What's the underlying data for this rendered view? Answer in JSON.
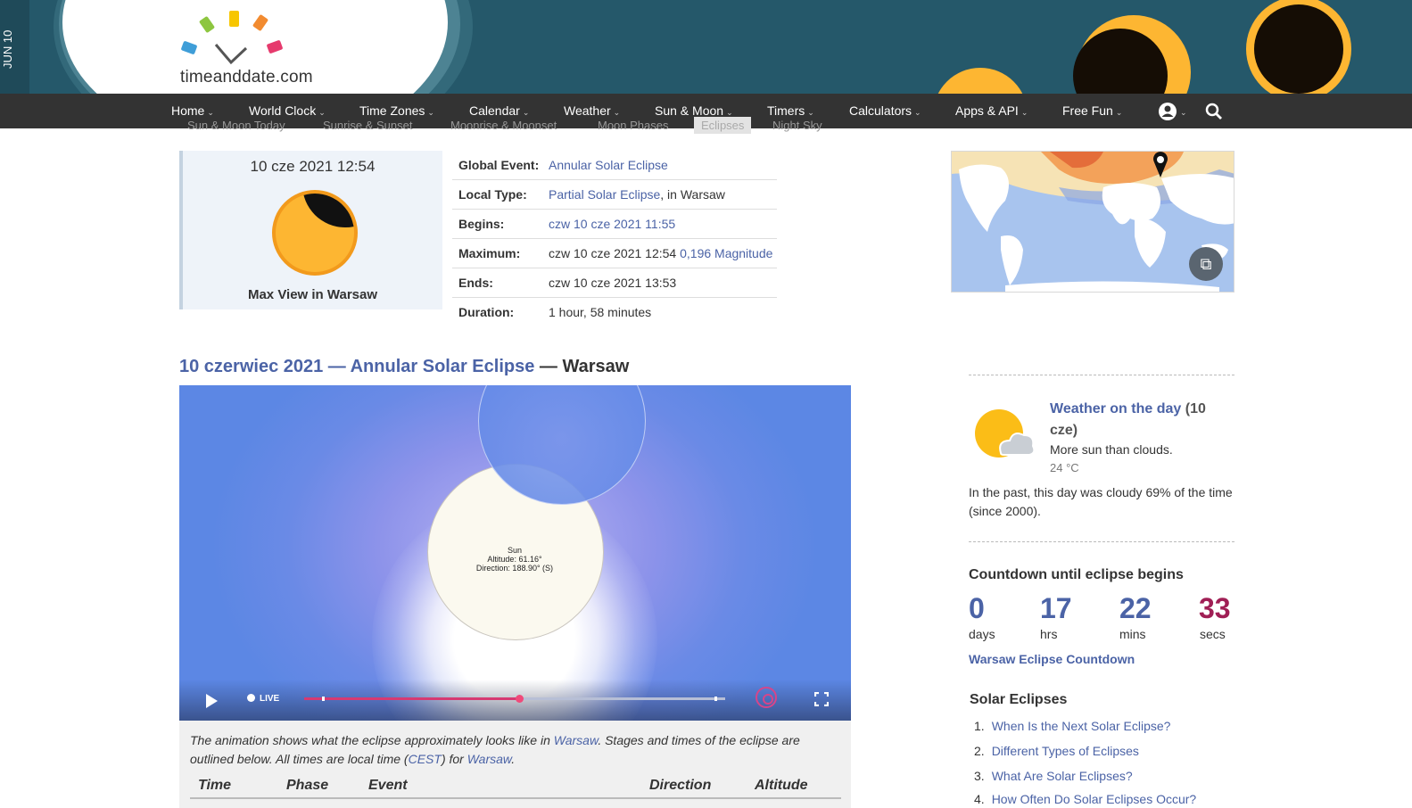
{
  "header": {
    "date_strip": "JUN 10",
    "logo_text": "timeanddate.com",
    "colors": {
      "banner": "#25586a",
      "sun": "#fdb632",
      "logo_bars": [
        "#3f9ed8",
        "#8dc63f",
        "#f7c600",
        "#f28b30",
        "#e63a6d"
      ]
    }
  },
  "nav": {
    "items": [
      {
        "label": "Home"
      },
      {
        "label": "World Clock"
      },
      {
        "label": "Time Zones"
      },
      {
        "label": "Calendar"
      },
      {
        "label": "Weather"
      },
      {
        "label": "Sun & Moon"
      },
      {
        "label": "Timers"
      },
      {
        "label": "Calculators"
      },
      {
        "label": "Apps & API"
      },
      {
        "label": "Free Fun"
      }
    ],
    "account_icon": "user-circle-icon",
    "search_icon": "search-icon"
  },
  "subnav": {
    "items": [
      "Sun & Moon Today",
      "Sunrise & Sunset",
      "Moonrise & Moonset",
      "Moon Phases",
      "Eclipses",
      "Night Sky"
    ],
    "active": "Eclipses"
  },
  "maxview": {
    "datetime": "10 cze 2021 12:54",
    "label": "Max View in Warsaw"
  },
  "eclipse_info": {
    "rows": [
      {
        "key": "Global Event:",
        "link": "Annular Solar Eclipse",
        "text": ""
      },
      {
        "key": "Local Type:",
        "link": "Partial Solar Eclipse",
        "text": ", in Warsaw"
      },
      {
        "key": "Begins:",
        "link": "czw 10 cze 2021 11:55",
        "text": ""
      },
      {
        "key": "Maximum:",
        "text": "czw 10 cze 2021 12:54 ",
        "link": "0,196 Magnitude"
      },
      {
        "key": "Ends:",
        "text": "czw 10 cze 2021 13:53",
        "link": ""
      },
      {
        "key": "Duration:",
        "text": "1 hour, 58 minutes",
        "link": ""
      }
    ]
  },
  "heading": {
    "link": "10 czerwiec 2021 — Annular Solar Eclipse",
    "rest": " — Warsaw"
  },
  "animation": {
    "sun_label": "Sun",
    "altitude": "Altitude: 61.16°",
    "direction": "Direction: 188.90° (S)",
    "live_label": "LIVE",
    "progress": 0.51,
    "description_parts": {
      "p1": "The animation shows what the eclipse approximately looks like in ",
      "l1": "Warsaw",
      "p2": ". Stages and times of the eclipse are outlined below. All times are local time (",
      "l2": "CEST",
      "p3": ") for ",
      "l3": "Warsaw",
      "p4": "."
    }
  },
  "table_headers": [
    "Time",
    "Phase",
    "Event",
    "Direction",
    "Altitude"
  ],
  "weather": {
    "title_link": "Weather on the day",
    "title_rest": " (10 cze)",
    "desc": "More sun than clouds.",
    "temp": "24 °C",
    "past": "In the past, this day was cloudy 69% of the time (since 2000)."
  },
  "countdown": {
    "title": "Countdown until eclipse begins",
    "units": [
      {
        "value": "0",
        "label": "days"
      },
      {
        "value": "17",
        "label": "hrs"
      },
      {
        "value": "22",
        "label": "mins"
      },
      {
        "value": "33",
        "label": "secs"
      }
    ],
    "link": "Warsaw Eclipse Countdown"
  },
  "solar_eclipses": {
    "title": "Solar Eclipses",
    "items": [
      {
        "num": "1.",
        "label": "When Is the Next Solar Eclipse?"
      },
      {
        "num": "2.",
        "label": "Different Types of Eclipses"
      },
      {
        "num": "3.",
        "label": "What Are Solar Eclipses?"
      },
      {
        "num": "4.",
        "label": "How Often Do Solar Eclipses Occur?"
      }
    ]
  }
}
